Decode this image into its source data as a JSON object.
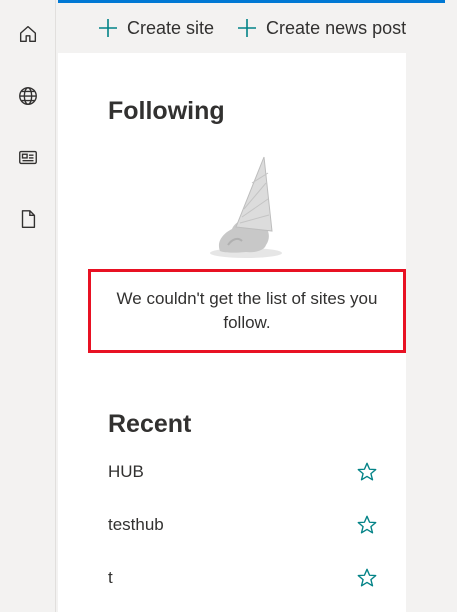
{
  "toolbar": {
    "create_site_label": "Create site",
    "create_news_label": "Create news post"
  },
  "left_rail": {
    "icons": [
      "home-icon",
      "globe-icon",
      "news-icon",
      "document-icon"
    ]
  },
  "following": {
    "title": "Following",
    "error_message": "We couldn't get the list of sites you follow."
  },
  "recent": {
    "title": "Recent",
    "items": [
      {
        "name": "HUB"
      },
      {
        "name": "testhub"
      },
      {
        "name": "t"
      }
    ]
  },
  "colors": {
    "accent": "#0078d4",
    "icon_teal": "#038387",
    "highlight_border": "#e81123"
  }
}
